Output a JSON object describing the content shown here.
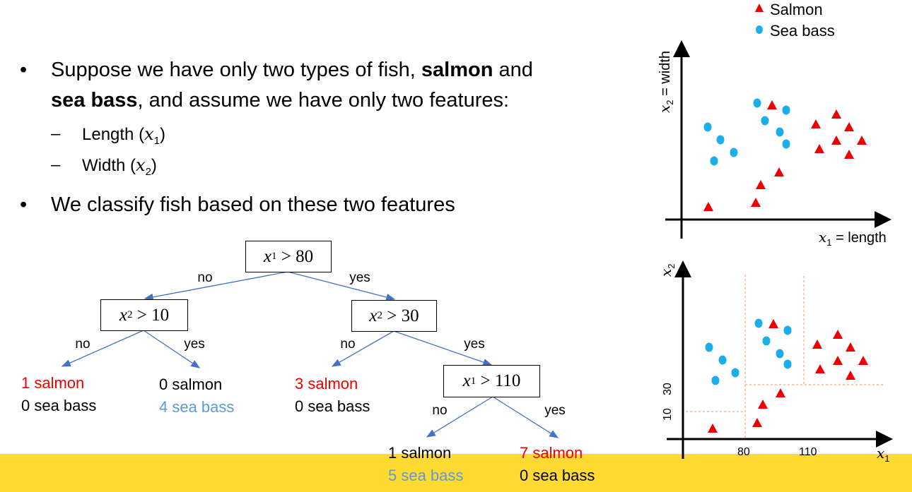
{
  "bullets": [
    {
      "pre": "Suppose we have only two types of fish, ",
      "b1": "salmon",
      "mid": " and",
      "b2": "sea bass",
      "post": ", and assume we have only two features:"
    },
    {
      "text": "We classify fish based on these two features"
    }
  ],
  "features": [
    {
      "name": "Length",
      "var": "x",
      "sub": "1"
    },
    {
      "name": "Width",
      "var": "x",
      "sub": "2"
    }
  ],
  "tree": {
    "nodes": [
      {
        "var": "x",
        "sub": "1",
        "op": ">",
        "val": "80"
      },
      {
        "var": "x",
        "sub": "2",
        "op": ">",
        "val": "10"
      },
      {
        "var": "x",
        "sub": "2",
        "op": ">",
        "val": "30"
      },
      {
        "var": "x",
        "sub": "1",
        "op": ">",
        "val": "110"
      }
    ],
    "edge_labels": {
      "no": "no",
      "yes": "yes"
    },
    "leaves": [
      {
        "salmon": "1 salmon",
        "seabass": "0 sea bass"
      },
      {
        "salmon": "0 salmon",
        "seabass": "4 sea bass"
      },
      {
        "salmon": "3 salmon",
        "seabass": "0 sea bass"
      },
      {
        "salmon": "1 salmon",
        "seabass": "5 sea bass"
      },
      {
        "salmon": "7 salmon",
        "seabass": "0 sea bass"
      }
    ]
  },
  "legend": {
    "salmon": "Salmon",
    "seabass": "Sea bass"
  },
  "plot1": {
    "ylabel_var": "x",
    "ylabel_sub": "2",
    "ylabel_text": " = width",
    "xlabel_var": "x",
    "xlabel_sub": "1",
    "xlabel_text": " = length"
  },
  "plot2": {
    "ylabel_var": "x",
    "ylabel_sub": "2",
    "xlabel_var": "x",
    "xlabel_sub": "1",
    "x_ticks": [
      "80",
      "110"
    ],
    "y_ticks": [
      "10",
      "30"
    ]
  },
  "colors": {
    "salmon": "#EE0000",
    "seabass": "#1BAEE8",
    "arrow": "#4472C4",
    "seabass_text": "#5B9BD5",
    "split": "#F4A582",
    "band": "#FFDA33"
  }
}
